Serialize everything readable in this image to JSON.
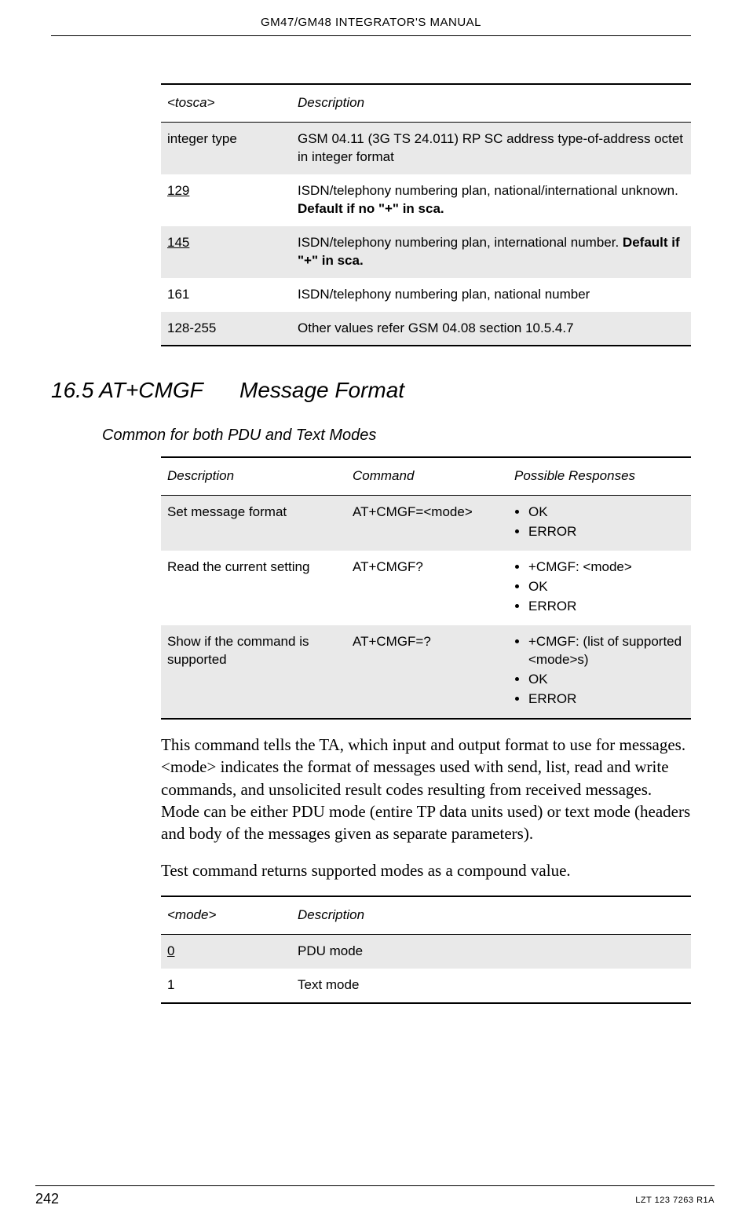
{
  "header": "GM47/GM48 INTEGRATOR'S MANUAL",
  "table1": {
    "head": {
      "c1": "<tosca>",
      "c2": "Description"
    },
    "rows": [
      {
        "c1": "integer type",
        "c2": "GSM 04.11 (3G TS 24.011) RP SC address type-of-address octet in integer format"
      },
      {
        "c1": "129",
        "c2a": "ISDN/telephony numbering plan, national/international unknown. ",
        "c2b": "Default if no \"+\" in sca."
      },
      {
        "c1": "145",
        "c2a": "ISDN/telephony numbering plan, international number. ",
        "c2b": "Default if \"+\" in sca."
      },
      {
        "c1": "161",
        "c2": "ISDN/telephony numbering plan, national number"
      },
      {
        "c1": "128-255",
        "c2": "Other values refer GSM 04.08 section 10.5.4.7"
      }
    ]
  },
  "section": {
    "num": "16.5 AT+CMGF",
    "title": "Message Format"
  },
  "subtitle": "Common for both PDU and Text Modes",
  "table2": {
    "head": {
      "c1": "Description",
      "c2": "Command",
      "c3": "Possible Responses"
    },
    "rows": [
      {
        "c1": "Set message format",
        "c2": "AT+CMGF=<mode>",
        "r": [
          "OK",
          "ERROR"
        ]
      },
      {
        "c1": "Read the current setting",
        "c2": "AT+CMGF?",
        "r": [
          "+CMGF: <mode>",
          "OK",
          "ERROR"
        ]
      },
      {
        "c1": "Show if the command is supported",
        "c2": "AT+CMGF=?",
        "r": [
          "+CMGF: (list of supported <mode>s)",
          "OK",
          "ERROR"
        ]
      }
    ]
  },
  "para1": "This command tells the TA, which input and output format to use for messages. <mode> indicates the format of messages used with send, list, read and write commands, and unsolicited result codes resulting from received messages. Mode can be either PDU mode (entire TP data units used) or text mode (headers and body of the messages given as separate parameters).",
  "para2": "Test command returns supported modes as a compound value.",
  "table3": {
    "head": {
      "c1": "<mode>",
      "c2": "Description"
    },
    "rows": [
      {
        "c1": "0",
        "c2": "PDU mode"
      },
      {
        "c1": "1",
        "c2": "Text mode"
      }
    ]
  },
  "footer": {
    "page": "242",
    "doc": "LZT 123 7263 R1A"
  }
}
